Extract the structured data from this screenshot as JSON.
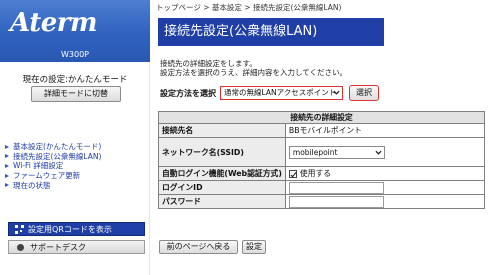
{
  "brand": {
    "logo": "Aterm",
    "model": "W300P"
  },
  "sidebar": {
    "current_mode": "現在の設定:かんたんモード",
    "switch_button": "詳細モードに切替",
    "nav": [
      {
        "label": "基本設定(かんたんモード)"
      },
      {
        "label": "接続先設定(公衆無線LAN)"
      },
      {
        "label": "Wi-Fi 詳細設定"
      },
      {
        "label": "ファームウェア更新"
      },
      {
        "label": "現在の状態"
      }
    ],
    "qr_button": "設定用QRコードを表示",
    "support_button": "サポートデスク"
  },
  "header": {
    "breadcrumb": "トップページ > 基本設定 > 接続先設定(公衆無線LAN)",
    "title": "接続先設定(公衆無線LAN)"
  },
  "description": [
    "接続先の詳細設定をします。",
    "設定方法を選択のうえ、詳細内容を入力してください。"
  ],
  "method": {
    "label": "設定方法を選択",
    "selected": "通常の無線LANアクセスポイント",
    "button": "選択"
  },
  "details": {
    "heading": "接続先の詳細設定",
    "rows": {
      "connection_name": {
        "label": "接続先名",
        "value": "BBモバイルポイント"
      },
      "ssid": {
        "label": "ネットワーク名(SSID)",
        "value": "mobilepoint"
      },
      "auto_login": {
        "label": "自動ログイン機能(Web認証方式)",
        "checkbox_label": "使用する",
        "checked": true
      },
      "login_id": {
        "label": "ログインID",
        "value": ""
      },
      "password": {
        "label": "パスワード",
        "value": ""
      }
    }
  },
  "footer": {
    "prev_button": "前のページへ戻る",
    "set_button": "設定"
  },
  "colors": {
    "brand_blue": "#1f3fa6",
    "highlight_red": "#dd3333"
  }
}
